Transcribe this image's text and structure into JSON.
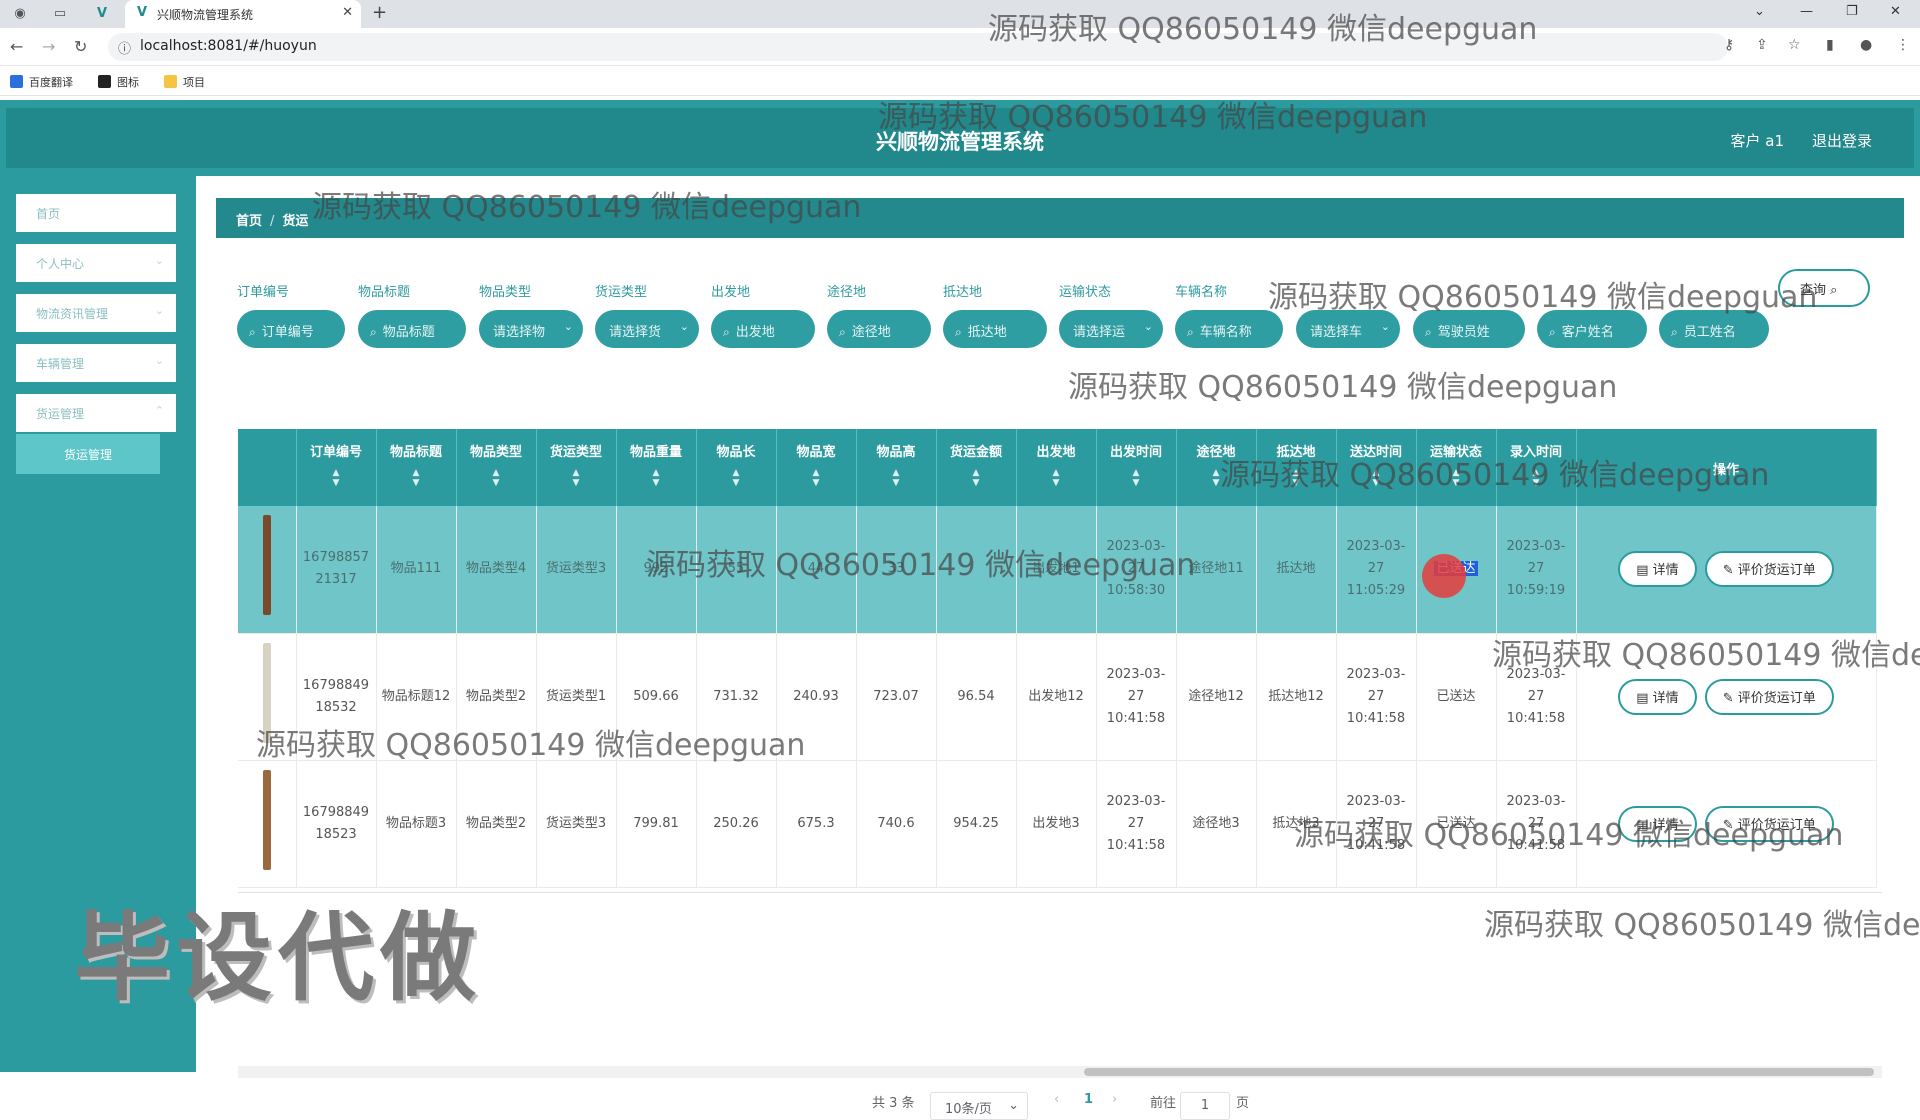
{
  "browser": {
    "tab_title": "兴顺物流管理系统",
    "url": "localhost:8081/#/huoyun",
    "bookmarks": [
      "百度翻译",
      "图标",
      "项目"
    ]
  },
  "header": {
    "title": "兴顺物流管理系统",
    "user": "客户 a1",
    "logout": "退出登录"
  },
  "sidebar": {
    "items": [
      {
        "label": "首页",
        "has_chevron": false
      },
      {
        "label": "个人中心",
        "has_chevron": true
      },
      {
        "label": "物流资讯管理",
        "has_chevron": true
      },
      {
        "label": "车辆管理",
        "has_chevron": true
      },
      {
        "label": "货运管理",
        "has_chevron": true
      }
    ],
    "active_sub": "货运管理"
  },
  "breadcrumb": [
    "首页",
    "货运"
  ],
  "filters": {
    "labels": [
      "订单编号",
      "物品标题",
      "物品类型",
      "货运类型",
      "出发地",
      "途径地",
      "抵达地",
      "运输状态",
      "车辆名称"
    ],
    "pills": [
      "订单编号",
      "物品标题",
      "请选择物",
      "请选择货",
      "出发地",
      "途径地",
      "抵达地",
      "请选择运",
      "车辆名称",
      "请选择车",
      "驾驶员姓",
      "客户姓名",
      "员工姓名"
    ],
    "query_label": "查询"
  },
  "table": {
    "columns": [
      "订单编号",
      "物品标题",
      "物品类型",
      "货运类型",
      "物品重量",
      "物品长",
      "物品宽",
      "物品高",
      "货运金额",
      "出发地",
      "出发时间",
      "途径地",
      "抵达地",
      "送达时间",
      "运输状态",
      "录入时间",
      "操作"
    ],
    "rows": [
      {
        "order": "1679885721317",
        "title": "物品111",
        "item_type": "物品类型4",
        "ship_type": "货运类型3",
        "weight": "992",
        "length": "55",
        "width": "44",
        "height": "33",
        "amount": "",
        "from": "出发地1",
        "depart": "2023-03-27 10:58:30",
        "via": "途径地11",
        "to": "抵达地",
        "delivered": "2023-03-27 11:05:29",
        "status": "已送达",
        "created": "2023-03-27 10:59:19",
        "highlight": true
      },
      {
        "order": "1679884918532",
        "title": "物品标题12",
        "item_type": "物品类型2",
        "ship_type": "货运类型1",
        "weight": "509.66",
        "length": "731.32",
        "width": "240.93",
        "height": "723.07",
        "amount": "96.54",
        "from": "出发地12",
        "depart": "2023-03-27 10:41:58",
        "via": "途径地12",
        "to": "抵达地12",
        "delivered": "2023-03-27 10:41:58",
        "status": "已送达",
        "created": "2023-03-27 10:41:58",
        "highlight": false
      },
      {
        "order": "1679884918523",
        "title": "物品标题3",
        "item_type": "物品类型2",
        "ship_type": "货运类型3",
        "weight": "799.81",
        "length": "250.26",
        "width": "675.3",
        "height": "740.6",
        "amount": "954.25",
        "from": "出发地3",
        "depart": "2023-03-27 10:41:58",
        "via": "途径地3",
        "to": "抵达地3",
        "delivered": "2023-03-27 10:41:58",
        "status": "已送达",
        "created": "2023-03-27 10:41:58",
        "highlight": false
      }
    ],
    "action_detail": "详情",
    "action_review": "评价货运订单"
  },
  "pagination": {
    "total": "共 3 条",
    "page_size": "10条/页",
    "current": "1",
    "goto_prefix": "前往",
    "goto_value": "1",
    "goto_suffix": "页"
  },
  "watermarks": {
    "text": "源码获取 QQ86050149 微信deepguan",
    "big": "毕设代做"
  },
  "colors": {
    "teal": "#2b9b9f",
    "teal_dark": "#21888c",
    "row_highlight": "#6fc5c8"
  }
}
